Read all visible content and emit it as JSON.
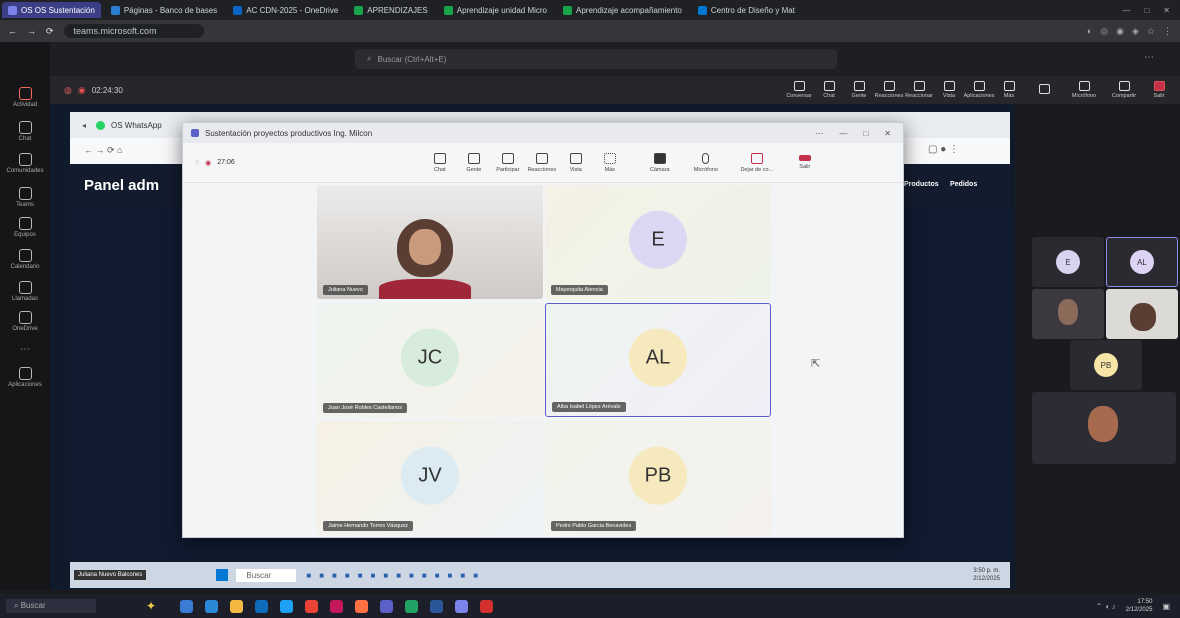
{
  "browser": {
    "tabs": [
      {
        "label": "OS OS Sustentación"
      },
      {
        "label": "Páginas - Banco de bases"
      },
      {
        "label": "AC CDN-2025 - OneDrive"
      },
      {
        "label": "APRENDIZAJES"
      },
      {
        "label": "Aprendizaje unidad Micro"
      },
      {
        "label": "Aprendizaje acompañamiento"
      },
      {
        "label": "Centro de Diseño y Mat"
      }
    ],
    "url": "teams.microsoft.com"
  },
  "teams": {
    "search_placeholder": "Buscar (Ctrl+Alt+E)",
    "meeting_timer": "02:24:30",
    "toolbar": [
      {
        "label": "Conversar"
      },
      {
        "label": "Chat"
      },
      {
        "label": "Gente"
      },
      {
        "label": "Reacciones"
      },
      {
        "label": "Reaccionar"
      },
      {
        "label": "Vista"
      },
      {
        "label": "Aplicaciones"
      },
      {
        "label": "Más"
      },
      {
        "label": "Micrófono"
      },
      {
        "label": "Compartir"
      },
      {
        "label": "Salir"
      }
    ],
    "rail": [
      {
        "label": "Actividad"
      },
      {
        "label": "Chat"
      },
      {
        "label": "Comunidades"
      },
      {
        "label": "Teams"
      },
      {
        "label": "Equipos"
      },
      {
        "label": "Calendario"
      },
      {
        "label": "Llamadas"
      },
      {
        "label": "OneDrive"
      },
      {
        "label": "Aplicaciones"
      }
    ]
  },
  "shared": {
    "inner_tab_1": "OS WhatsApp",
    "panel_title": "Panel adm",
    "panel_nav_1": "Productos",
    "panel_nav_2": "Pedidos"
  },
  "call": {
    "title": "Sustentación proyectos productivos Ing. Milcon",
    "timer": "27:06",
    "toolbar": [
      {
        "label": "Chat"
      },
      {
        "label": "Gente"
      },
      {
        "label": "Participar"
      },
      {
        "label": "Reacciones"
      },
      {
        "label": "Vista"
      },
      {
        "label": "Más"
      }
    ],
    "camera_label": "Cámara",
    "mic_label": "Micrófono",
    "share_label": "Dejar de co...",
    "leave_label": "Salir",
    "participants": [
      {
        "initials": "",
        "name": "Juliana Nuevo",
        "video": true
      },
      {
        "initials": "E",
        "name": "Mayerquita Atencia",
        "color": "#dcd8f3"
      },
      {
        "initials": "JC",
        "name": "Juan José Robles Castellanos",
        "color": "#d7ecdc"
      },
      {
        "initials": "AL",
        "name": "Alba Isabel López Arévalo",
        "color": "#f6e9bd"
      },
      {
        "initials": "JV",
        "name": "Jaime Hernando Torres Vásquez",
        "color": "#dcebf2"
      },
      {
        "initials": "PB",
        "name": "Pedro Pablo Garcia Benavides",
        "color": "#f6e9bd"
      }
    ]
  },
  "gallery": [
    {
      "initials": "E",
      "color": "#d7d3f1"
    },
    {
      "initials": "AL",
      "color": "#dcd3f5"
    },
    {
      "initials": "PB",
      "color": "#f6e5a6"
    }
  ],
  "inner_taskbar": {
    "search": "Buscar",
    "status": "Juliana Nuevo Balcones",
    "time": "3:50 p. m.",
    "date": "2/12/2025"
  },
  "taskbar": {
    "search": "Buscar",
    "time": "17:50",
    "date": "2/12/2025"
  }
}
